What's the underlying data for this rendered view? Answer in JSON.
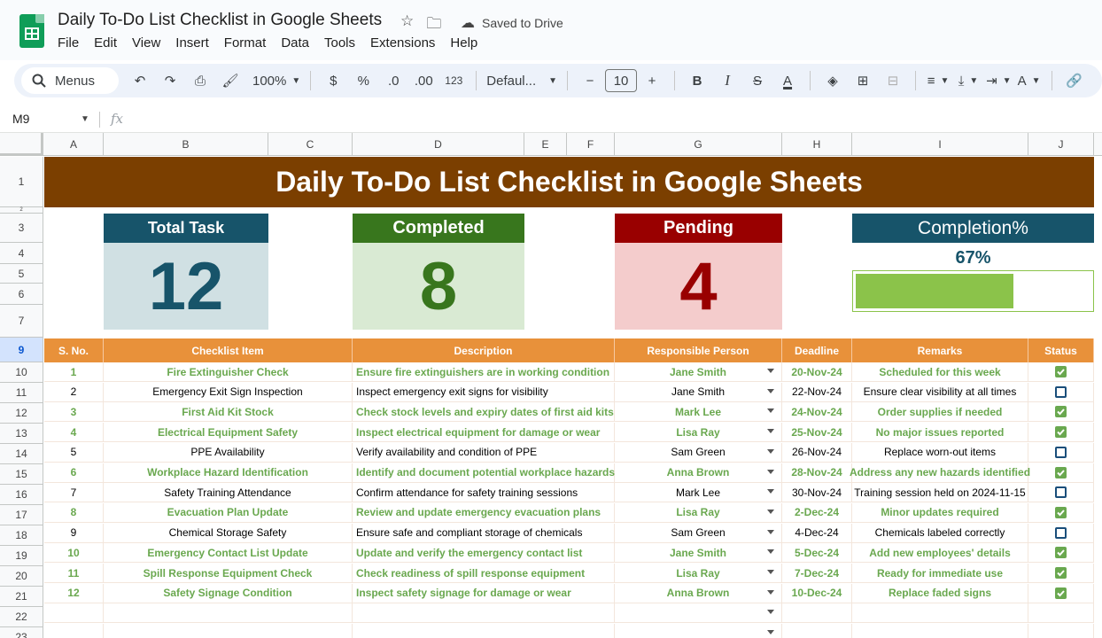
{
  "app": {
    "doc_title": "Daily To-Do List Checklist in Google Sheets",
    "saved_status": "Saved to Drive",
    "menu": [
      "File",
      "Edit",
      "View",
      "Insert",
      "Format",
      "Data",
      "Tools",
      "Extensions",
      "Help"
    ]
  },
  "toolbar": {
    "search_label": "Menus",
    "zoom": "100%",
    "currency": "$",
    "percent": "%",
    "decrease_decimal": ".0",
    "increase_decimal": ".00",
    "number_format": "123",
    "font": "Defaul...",
    "font_size": "10"
  },
  "formula_bar": {
    "cell_ref": "M9",
    "fx": "fx"
  },
  "columns": [
    "A",
    "B",
    "C",
    "D",
    "E",
    "F",
    "G",
    "H",
    "I",
    "J"
  ],
  "rows": [
    "1",
    "2",
    "3",
    "4",
    "5",
    "6",
    "7",
    "9",
    "10",
    "11",
    "12",
    "13",
    "14",
    "15",
    "16",
    "17",
    "18",
    "19",
    "20",
    "21",
    "22",
    "23"
  ],
  "selected_row": "9",
  "banner": "Daily To-Do List Checklist in Google Sheets",
  "cards": {
    "total": {
      "label": "Total Task",
      "value": "12"
    },
    "completed": {
      "label": "Completed",
      "value": "8"
    },
    "pending": {
      "label": "Pending",
      "value": "4"
    },
    "completion": {
      "label": "Completion%",
      "value": "67%",
      "fraction": 0.67
    }
  },
  "colors": {
    "banner": "#7b3f00",
    "total_head": "#17546a",
    "total_body": "#d0e0e3",
    "completed_head": "#38761d",
    "completed_body": "#d9ead3",
    "pending_head": "#990000",
    "pending_body": "#f4cccc",
    "header_orange": "#e8913a",
    "done_green": "#6aa84f"
  },
  "table": {
    "headers": [
      "S. No.",
      "Checklist Item",
      "Description",
      "Responsible Person",
      "Deadline",
      "Remarks",
      "Status"
    ],
    "rows": [
      {
        "no": "1",
        "item": "Fire Extinguisher Check",
        "desc": "Ensure fire extinguishers are in working condition",
        "person": "Jane Smith",
        "deadline": "20-Nov-24",
        "remarks": "Scheduled for this week",
        "done": true
      },
      {
        "no": "2",
        "item": "Emergency Exit Sign Inspection",
        "desc": "Inspect emergency exit signs for visibility",
        "person": "Jane Smith",
        "deadline": "22-Nov-24",
        "remarks": "Ensure clear visibility at all times",
        "done": false
      },
      {
        "no": "3",
        "item": "First Aid Kit Stock",
        "desc": "Check stock levels and expiry dates of first aid kits",
        "person": "Mark Lee",
        "deadline": "24-Nov-24",
        "remarks": "Order supplies if needed",
        "done": true
      },
      {
        "no": "4",
        "item": "Electrical Equipment Safety",
        "desc": "Inspect electrical equipment for damage or wear",
        "person": "Lisa Ray",
        "deadline": "25-Nov-24",
        "remarks": "No major issues reported",
        "done": true
      },
      {
        "no": "5",
        "item": "PPE Availability",
        "desc": "Verify availability and condition of PPE",
        "person": "Sam Green",
        "deadline": "26-Nov-24",
        "remarks": "Replace worn-out items",
        "done": false
      },
      {
        "no": "6",
        "item": "Workplace Hazard Identification",
        "desc": "Identify and document potential workplace hazards",
        "person": "Anna Brown",
        "deadline": "28-Nov-24",
        "remarks": "Address any new hazards identified",
        "done": true
      },
      {
        "no": "7",
        "item": "Safety Training Attendance",
        "desc": "Confirm attendance for safety training sessions",
        "person": "Mark Lee",
        "deadline": "30-Nov-24",
        "remarks": "Training session held on 2024-11-15",
        "done": false
      },
      {
        "no": "8",
        "item": "Evacuation Plan Update",
        "desc": "Review and update emergency evacuation plans",
        "person": "Lisa Ray",
        "deadline": "2-Dec-24",
        "remarks": "Minor updates required",
        "done": true
      },
      {
        "no": "9",
        "item": "Chemical Storage Safety",
        "desc": "Ensure safe and compliant storage of chemicals",
        "person": "Sam Green",
        "deadline": "4-Dec-24",
        "remarks": "Chemicals labeled correctly",
        "done": false
      },
      {
        "no": "10",
        "item": "Emergency Contact List Update",
        "desc": "Update and verify the emergency contact list",
        "person": "Jane Smith",
        "deadline": "5-Dec-24",
        "remarks": "Add new employees' details",
        "done": true
      },
      {
        "no": "11",
        "item": "Spill Response Equipment Check",
        "desc": "Check readiness of spill response equipment",
        "person": "Lisa Ray",
        "deadline": "7-Dec-24",
        "remarks": "Ready for immediate use",
        "done": true
      },
      {
        "no": "12",
        "item": "Safety Signage Condition",
        "desc": "Inspect safety signage for damage or wear",
        "person": "Anna Brown",
        "deadline": "10-Dec-24",
        "remarks": "Replace faded signs",
        "done": true
      }
    ]
  }
}
